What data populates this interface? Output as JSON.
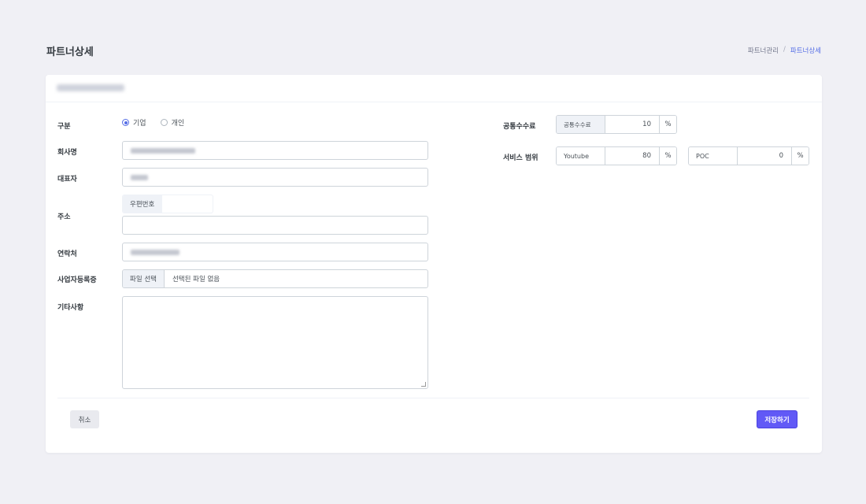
{
  "page": {
    "title": "파트너상세",
    "breadcrumb": {
      "parent": "파트너관리",
      "separator": "/",
      "current": "파트너상세"
    }
  },
  "form": {
    "type": {
      "label": "구분",
      "options": [
        "기업",
        "개인"
      ],
      "selected": "기업"
    },
    "company": {
      "label": "회사명",
      "value": ""
    },
    "ceo": {
      "label": "대표자",
      "value": ""
    },
    "address": {
      "label": "주소",
      "zip_label": "우편번호",
      "zip_value": "",
      "detail_value": ""
    },
    "contact": {
      "label": "연락처",
      "value": ""
    },
    "business_reg": {
      "label": "사업자등록증",
      "button": "파일 선택",
      "status": "선택된 파일 없음"
    },
    "notes": {
      "label": "기타사항",
      "value": ""
    }
  },
  "right": {
    "common_fee": {
      "label": "공통수수료",
      "addon": "공통수수료",
      "value": "10",
      "unit": "%"
    },
    "service_scope": {
      "label": "서비스 범위",
      "items": [
        {
          "name": "Youtube",
          "value": "80",
          "unit": "%"
        },
        {
          "name": "POC",
          "value": "0",
          "unit": "%"
        }
      ]
    }
  },
  "actions": {
    "cancel": "취소",
    "save": "저장하기"
  },
  "colors": {
    "primary": "#556ee6",
    "save_button": "#6159f6",
    "background": "#f0f0f5"
  }
}
